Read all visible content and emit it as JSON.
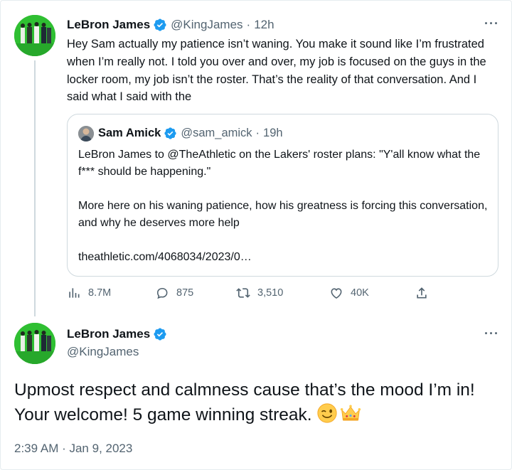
{
  "tweet1": {
    "name": "LeBron James",
    "handle": "@KingJames",
    "time": "12h",
    "text": "Hey Sam actually my patience isn’t waning. You make it sound like I’m frustrated when I’m really not. I told you over and over, my job is focused on the guys in the locker room, my job isn’t the roster. That’s the reality of that conversation. And I said what I said with the",
    "quote": {
      "name": "Sam Amick",
      "handle": "@sam_amick",
      "time": "19h",
      "paragraph1": "LeBron James to @TheAthletic on the Lakers' roster plans: \"Y'all know what the f*** should be happening.\"",
      "paragraph2": "More here on his waning patience, how his greatness is forcing this conversation, and why he deserves more help",
      "link": "theathletic.com/4068034/2023/0…"
    },
    "actions": {
      "views": "8.7M",
      "replies": "875",
      "retweets": "3,510",
      "likes": "40K"
    }
  },
  "tweet2": {
    "name": "LeBron James",
    "handle": "@KingJames",
    "text": "Upmost respect and calmness cause that’s the mood I’m in! Your welcome! 5 game winning streak.",
    "emojis": [
      "winking-face",
      "crown"
    ],
    "timestamp": "2:39 AM · Jan 9, 2023"
  },
  "colors": {
    "text": "#0f1419",
    "secondary": "#536471",
    "verified": "#1d9bf0",
    "border": "#cfd9de",
    "avatar_bg": "#2fbf32"
  },
  "separator": "·",
  "more_glyph": "···"
}
